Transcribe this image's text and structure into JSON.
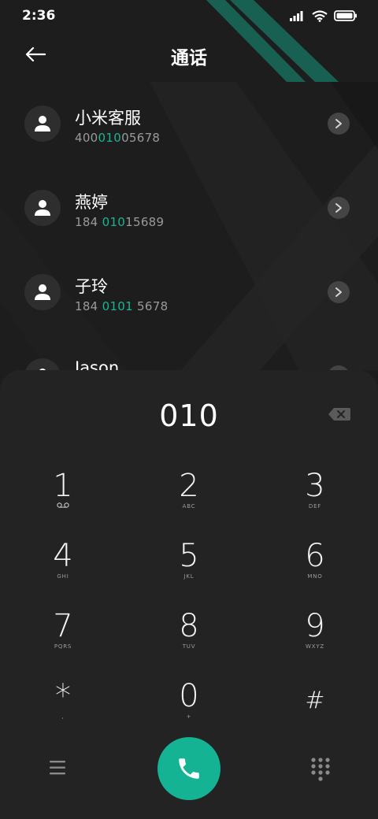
{
  "status": {
    "time": "2:36"
  },
  "header": {
    "title": "通话"
  },
  "contacts": [
    {
      "name": "小米客服",
      "number_parts": [
        "400",
        "010",
        "05678"
      ]
    },
    {
      "name": "燕婷",
      "number_parts": [
        "184 ",
        "010",
        "15689"
      ]
    },
    {
      "name": "子玲",
      "number_parts": [
        "184 ",
        "0101",
        " 5678"
      ]
    },
    {
      "name": "Jason",
      "number_parts": [
        "",
        "",
        ""
      ]
    }
  ],
  "dialpad": {
    "input": "010",
    "keys": [
      {
        "digit": "1",
        "sub": "voicemail-icon"
      },
      {
        "digit": "2",
        "sub": "ABC"
      },
      {
        "digit": "3",
        "sub": "DEF"
      },
      {
        "digit": "4",
        "sub": "GHI"
      },
      {
        "digit": "5",
        "sub": "JKL"
      },
      {
        "digit": "6",
        "sub": "MNO"
      },
      {
        "digit": "7",
        "sub": "PQRS"
      },
      {
        "digit": "8",
        "sub": "TUV"
      },
      {
        "digit": "9",
        "sub": "WXYZ"
      },
      {
        "digit": "*",
        "sub": ","
      },
      {
        "digit": "0",
        "sub": "+"
      },
      {
        "digit": "#",
        "sub": ""
      }
    ]
  },
  "colors": {
    "accent": "#14b394",
    "highlight": "#18b594",
    "background": "#1b1b1b",
    "dialpad_bg": "#232323"
  }
}
